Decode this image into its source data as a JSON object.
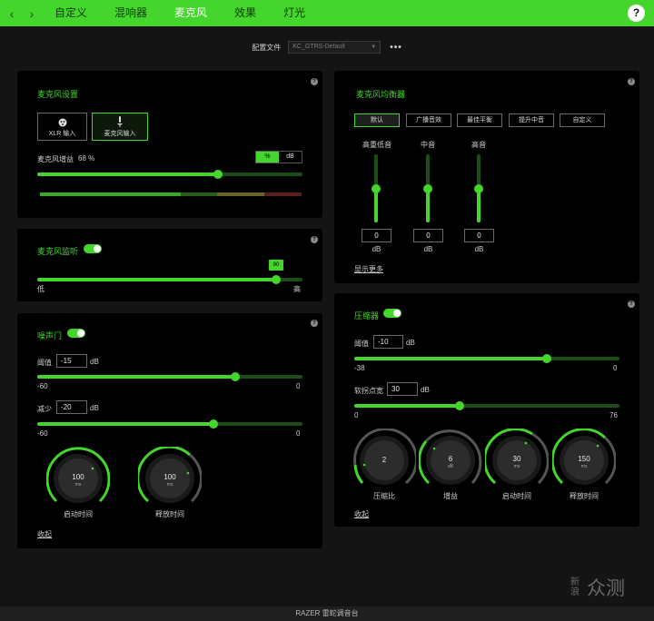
{
  "nav": {
    "back": "‹",
    "forward": "›",
    "tabs": [
      "自定义",
      "混响器",
      "麦克风",
      "效果",
      "灯光"
    ],
    "active_tab": "麦克风",
    "help": "?"
  },
  "profile": {
    "label": "配置文件",
    "value": "KC_GTRS-Default",
    "more": "•••"
  },
  "mic_settings": {
    "title": "麦克风设置",
    "xlr_label": "XLR 输入",
    "mic_input_label": "麦克风输入",
    "gain_label": "麦克风增益",
    "gain_value": "68 %",
    "gain_percent": 68,
    "unit_percent": "%",
    "unit_db": "dB"
  },
  "monitor": {
    "title": "麦克风监听",
    "value": "90",
    "level_percent": 90,
    "low": "低",
    "high": "高"
  },
  "noise_gate": {
    "title": "噪声门",
    "threshold_label": "阈值",
    "threshold_value": "-15",
    "threshold_unit": "dB",
    "threshold_min": "-60",
    "threshold_max": "0",
    "reduction_label": "减少",
    "reduction_value": "-20",
    "reduction_unit": "dB",
    "reduction_min": "-60",
    "reduction_max": "0",
    "attack_value": "100",
    "attack_unit": "ms",
    "attack_label": "启动时间",
    "release_value": "100",
    "release_unit": "ms",
    "release_label": "释放时间",
    "collapse": "收起"
  },
  "equalizer": {
    "title": "麦克风均衡器",
    "presets": [
      "默认",
      "广播音效",
      "最佳平衡",
      "提升中音",
      "自定义"
    ],
    "active_preset": "默认",
    "bands": [
      {
        "label": "高重低音",
        "value": "0",
        "unit": "dB"
      },
      {
        "label": "中音",
        "value": "0",
        "unit": "dB"
      },
      {
        "label": "高音",
        "value": "0",
        "unit": "dB"
      }
    ],
    "show_more": "显示更多"
  },
  "compressor": {
    "title": "压缩器",
    "threshold_label": "阈值",
    "threshold_value": "-10",
    "threshold_unit": "dB",
    "threshold_min": "-38",
    "threshold_max": "0",
    "knee_label": "软拐点宽",
    "knee_value": "30",
    "knee_unit": "dB",
    "knee_min": "0",
    "knee_max": "76",
    "ratio_value": "2",
    "ratio_label": "压缩比",
    "gain_value": "6",
    "gain_unit": "dB",
    "gain_label": "增益",
    "attack_value": "30",
    "attack_unit": "ms",
    "attack_label": "启动时间",
    "release_value": "150",
    "release_unit": "ms",
    "release_label": "释放时间",
    "collapse": "收起"
  },
  "footer": {
    "brand": "RAZER 雷蛇调音台"
  },
  "watermark": {
    "small": "新浪",
    "large": "众测"
  },
  "colors": {
    "accent": "#44d62c",
    "panel": "#000000",
    "background": "#141414"
  }
}
